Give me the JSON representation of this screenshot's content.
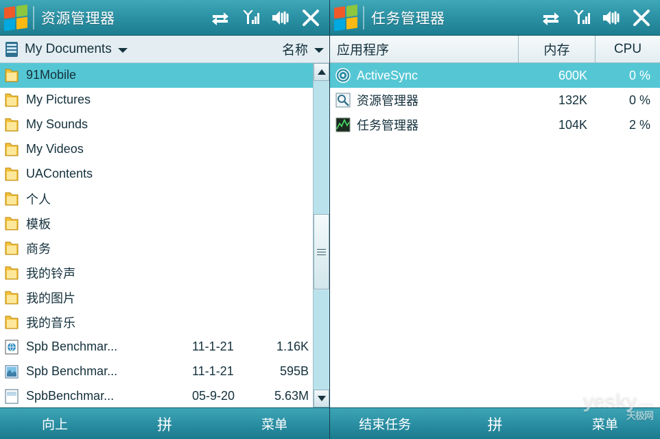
{
  "left_pane": {
    "titlebar": {
      "title": "资源管理器",
      "icons": [
        "activesync-icon",
        "signal-icon",
        "speaker-mute-icon",
        "close-icon"
      ]
    },
    "address_bar": {
      "folder_icon": "folder-open-icon",
      "folder_label": "My Documents",
      "dropdown_icon": "chevron-down-icon",
      "sort_label": "名称",
      "sort_dropdown_icon": "chevron-down-icon"
    },
    "files": [
      {
        "icon": "folder-icon",
        "name": "91Mobile",
        "date": "",
        "size": "",
        "selected": true
      },
      {
        "icon": "folder-icon",
        "name": "My Pictures",
        "date": "",
        "size": "",
        "selected": false
      },
      {
        "icon": "folder-icon",
        "name": "My Sounds",
        "date": "",
        "size": "",
        "selected": false
      },
      {
        "icon": "folder-icon",
        "name": "My Videos",
        "date": "",
        "size": "",
        "selected": false
      },
      {
        "icon": "folder-icon",
        "name": "UAContents",
        "date": "",
        "size": "",
        "selected": false
      },
      {
        "icon": "folder-icon",
        "name": "个人",
        "date": "",
        "size": "",
        "selected": false
      },
      {
        "icon": "folder-icon",
        "name": "模板",
        "date": "",
        "size": "",
        "selected": false
      },
      {
        "icon": "folder-icon",
        "name": "商务",
        "date": "",
        "size": "",
        "selected": false
      },
      {
        "icon": "folder-icon",
        "name": "我的铃声",
        "date": "",
        "size": "",
        "selected": false
      },
      {
        "icon": "folder-icon",
        "name": "我的图片",
        "date": "",
        "size": "",
        "selected": false
      },
      {
        "icon": "folder-icon",
        "name": "我的音乐",
        "date": "",
        "size": "",
        "selected": false
      },
      {
        "icon": "file-html-icon",
        "name": "Spb Benchmar...",
        "date": "11-1-21",
        "size": "1.16K",
        "selected": false
      },
      {
        "icon": "file-image-icon",
        "name": "Spb Benchmar...",
        "date": "11-1-21",
        "size": "595B",
        "selected": false
      },
      {
        "icon": "file-generic-icon",
        "name": "SpbBenchmar...",
        "date": "05-9-20",
        "size": "5.63M",
        "selected": false
      }
    ],
    "scrollbar": {
      "up_icon": "scroll-up-icon",
      "down_icon": "scroll-down-icon",
      "grip_icon": "scroll-grip-icon"
    },
    "softkeys": {
      "left": "向上",
      "middle": "拼",
      "right": "菜单"
    }
  },
  "right_pane": {
    "titlebar": {
      "title": "任务管理器",
      "icons": [
        "activesync-icon",
        "signal-icon",
        "speaker-mute-icon",
        "close-icon"
      ]
    },
    "columns": {
      "app": "应用程序",
      "memory": "内存",
      "cpu": "CPU"
    },
    "processes": [
      {
        "icon": "activesync-app-icon",
        "name": "ActiveSync",
        "memory": "600K",
        "cpu": "0 %",
        "selected": true
      },
      {
        "icon": "file-explorer-icon",
        "name": "资源管理器",
        "memory": "132K",
        "cpu": "0 %",
        "selected": false
      },
      {
        "icon": "task-manager-icon",
        "name": "任务管理器",
        "memory": "104K",
        "cpu": "2 %",
        "selected": false
      }
    ],
    "softkeys": {
      "left": "结束任务",
      "middle": "拼",
      "right": "菜单"
    }
  },
  "watermark": {
    "text": "yesky",
    "suffix": ".com",
    "cn": "天极网"
  },
  "colors": {
    "title_bar": "#2d93a6",
    "selection": "#55c7d4",
    "soft_bar": "#2b8fa3",
    "folder": "#f6c344"
  }
}
